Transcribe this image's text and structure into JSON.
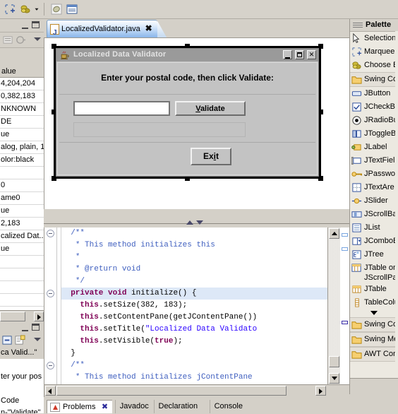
{
  "toolbar": {
    "buttons": [
      {
        "name": "marquee-tool",
        "icon": "marquee-icon"
      },
      {
        "name": "choose-bean-tool",
        "icon": "beans-icon"
      },
      {
        "name": "toolbar-dropdown",
        "icon": "chevron-down-icon"
      },
      {
        "name": "bean-viewer-tool",
        "icon": "bean-disc-icon"
      },
      {
        "name": "properties-tool",
        "icon": "properties-icon"
      }
    ]
  },
  "properties_view": {
    "header_value_col": "alue",
    "rows": [
      "4,204,204",
      "0,382,183",
      "NKNOWN",
      "DE",
      "ue",
      "alog, plain, 1",
      "olor:black",
      "",
      "0",
      "ame0",
      "ue",
      "2,183",
      "calized Dat...",
      "ue",
      "",
      "",
      "",
      ""
    ]
  },
  "outline_view": {
    "rows": [
      "ca Valid...\"",
      "",
      "ter your pos",
      "",
      "Code",
      "n-\"Validate\""
    ]
  },
  "editor": {
    "tab_label": "LocalizedValidator.java",
    "tab_close": "✖",
    "lines": [
      {
        "indent": 2,
        "fold": true,
        "hl": false,
        "parts": [
          {
            "t": "/**",
            "c": "cmt"
          }
        ]
      },
      {
        "indent": 3,
        "fold": false,
        "hl": false,
        "parts": [
          {
            "t": "* This method initializes this",
            "c": "cmt"
          }
        ]
      },
      {
        "indent": 3,
        "fold": false,
        "hl": false,
        "parts": [
          {
            "t": "*",
            "c": "cmt"
          }
        ]
      },
      {
        "indent": 3,
        "fold": false,
        "hl": false,
        "parts": [
          {
            "t": "* @return void",
            "c": "cmt"
          }
        ]
      },
      {
        "indent": 3,
        "fold": false,
        "hl": false,
        "parts": [
          {
            "t": "*/",
            "c": "cmt"
          }
        ]
      },
      {
        "indent": 2,
        "fold": true,
        "hl": true,
        "parts": [
          {
            "t": "private void ",
            "c": "kw"
          },
          {
            "t": "initialize() {",
            "c": "pln"
          }
        ]
      },
      {
        "indent": 4,
        "fold": false,
        "hl": false,
        "parts": [
          {
            "t": "this",
            "c": "kw"
          },
          {
            "t": ".setSize(382, 183);",
            "c": "pln"
          }
        ]
      },
      {
        "indent": 4,
        "fold": false,
        "hl": false,
        "parts": [
          {
            "t": "this",
            "c": "kw"
          },
          {
            "t": ".setContentPane(getJContentPane())",
            "c": "pln"
          }
        ]
      },
      {
        "indent": 4,
        "fold": false,
        "hl": false,
        "parts": [
          {
            "t": "this",
            "c": "kw"
          },
          {
            "t": ".setTitle(",
            "c": "pln"
          },
          {
            "t": "\"Localized Data Validato",
            "c": "str"
          }
        ]
      },
      {
        "indent": 4,
        "fold": false,
        "hl": false,
        "parts": [
          {
            "t": "this",
            "c": "kw"
          },
          {
            "t": ".setVisible(",
            "c": "pln"
          },
          {
            "t": "true",
            "c": "kw"
          },
          {
            "t": ");",
            "c": "pln"
          }
        ]
      },
      {
        "indent": 2,
        "fold": false,
        "hl": false,
        "parts": [
          {
            "t": "}",
            "c": "pln"
          }
        ]
      },
      {
        "indent": 2,
        "fold": true,
        "hl": false,
        "parts": [
          {
            "t": "/**",
            "c": "cmt"
          }
        ]
      },
      {
        "indent": 3,
        "fold": false,
        "hl": false,
        "parts": [
          {
            "t": "* This method initializes jContentPane",
            "c": "cmt"
          }
        ]
      }
    ]
  },
  "dialog": {
    "title": "Localized Data Validator",
    "prompt": "Enter your postal code, then click Validate:",
    "input_value": "",
    "validate_pre": "V",
    "validate_post": "alidate",
    "result_value": "",
    "exit_pre": "Ex",
    "exit_mn": "i",
    "exit_post": "t",
    "minimize_label": "_",
    "maximize_label": "□",
    "close_label": "✕"
  },
  "bottom_tabs": [
    {
      "label": "Problems",
      "active": true
    },
    {
      "label": "Javadoc",
      "active": false
    },
    {
      "label": "Declaration",
      "active": false
    },
    {
      "label": "Console",
      "active": false
    }
  ],
  "palette": {
    "title": "Palette",
    "items": [
      {
        "label": "Selection",
        "icon": "cursor-icon",
        "type": "item"
      },
      {
        "label": "Marquee",
        "icon": "marquee-icon",
        "type": "item"
      },
      {
        "label": "Choose B",
        "icon": "beans-icon",
        "type": "item"
      },
      {
        "label": "Swing Cor",
        "icon": "folder-icon",
        "type": "group"
      },
      {
        "label": "JButton",
        "icon": "jbutton-icon",
        "type": "item"
      },
      {
        "label": "JCheckBo",
        "icon": "jcheckbox-icon",
        "type": "item"
      },
      {
        "label": "JRadioBu",
        "icon": "jradio-icon",
        "type": "item"
      },
      {
        "label": "JToggleB",
        "icon": "jtoggle-icon",
        "type": "item"
      },
      {
        "label": "JLabel",
        "icon": "jlabel-icon",
        "type": "item"
      },
      {
        "label": "JTextFiel",
        "icon": "jtextfield-icon",
        "type": "item"
      },
      {
        "label": "JPasswor",
        "icon": "jpassword-icon",
        "type": "item"
      },
      {
        "label": "JTextAre",
        "icon": "jtextarea-icon",
        "type": "item"
      },
      {
        "label": "JSlider",
        "icon": "jslider-icon",
        "type": "item"
      },
      {
        "label": "JScrollBar",
        "icon": "jscrollbar-icon",
        "type": "item"
      },
      {
        "label": "JList",
        "icon": "jlist-icon",
        "type": "item"
      },
      {
        "label": "JComboB",
        "icon": "jcombobox-icon",
        "type": "item"
      },
      {
        "label": "JTree",
        "icon": "jtree-icon",
        "type": "item"
      },
      {
        "label": "JTable on\nJScrollPan",
        "icon": "jtable-scroll-icon",
        "type": "item2"
      },
      {
        "label": "JTable",
        "icon": "jtable-icon",
        "type": "item"
      },
      {
        "label": "TableColu",
        "icon": "tablecolumn-icon",
        "type": "item"
      },
      {
        "label": "Swing Cor",
        "icon": "folder-icon",
        "type": "group"
      },
      {
        "label": "Swing Me",
        "icon": "folder-icon",
        "type": "group"
      },
      {
        "label": "AWT Con",
        "icon": "folder-icon",
        "type": "group"
      }
    ]
  },
  "colors": {
    "tab_accent": "#8ab6ea",
    "keyword": "#7f0055",
    "string": "#2a00ff",
    "comment": "#3f5fbf",
    "highlight": "#dde8f7",
    "chrome": "#d4d0c8",
    "dialog_face": "#c3c3c3"
  }
}
